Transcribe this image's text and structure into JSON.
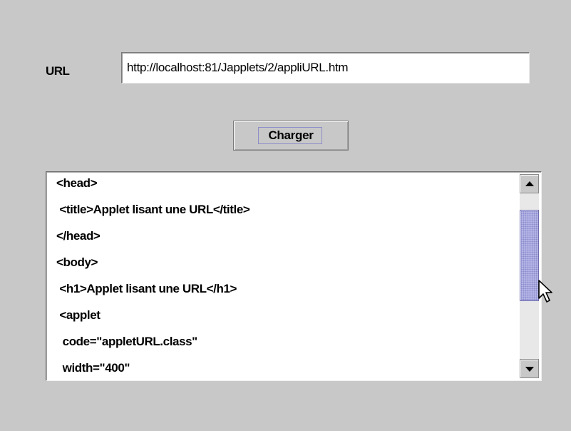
{
  "form": {
    "url_label": "URL",
    "url_value": "http://localhost:81/Japplets/2/appliURL.htm",
    "load_button_label": "Charger"
  },
  "content": {
    "lines": [
      "<head>",
      " <title>Applet lisant une URL</title>",
      "</head>",
      "<body>",
      " <h1>Applet lisant une URL</h1>",
      " <applet",
      "  code=\"appletURL.class\"",
      "  width=\"400\""
    ]
  },
  "scrollbar": {
    "position_fraction": 0.22,
    "visible_fraction": 0.55
  },
  "colors": {
    "background": "#c8c8c8",
    "thumb": "#b4b4e6",
    "focus_ring": "#8e8ec8"
  },
  "icons": {
    "scroll_up": "triangle-up",
    "scroll_down": "triangle-down",
    "cursor": "arrow-pointer"
  }
}
